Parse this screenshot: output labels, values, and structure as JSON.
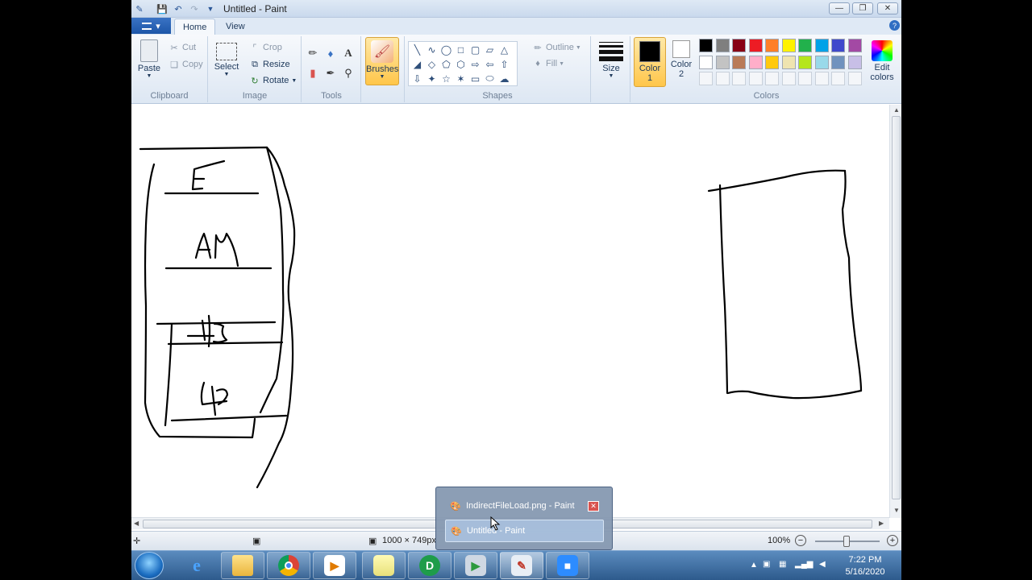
{
  "window": {
    "title": "Untitled - Paint",
    "quick_access_icons": [
      "save-icon",
      "undo-icon",
      "redo-icon"
    ]
  },
  "ribbon": {
    "file_button_label": "▾",
    "tabs": [
      {
        "label": "Home",
        "active": true
      },
      {
        "label": "View",
        "active": false
      }
    ],
    "clipboard": {
      "group_label": "Clipboard",
      "paste_label": "Paste",
      "cut_label": "Cut",
      "copy_label": "Copy"
    },
    "image": {
      "group_label": "Image",
      "select_label": "Select",
      "crop_label": "Crop",
      "resize_label": "Resize",
      "rotate_label": "Rotate"
    },
    "tools": {
      "group_label": "Tools"
    },
    "brushes": {
      "label": "Brushes"
    },
    "shapes": {
      "group_label": "Shapes",
      "outline_label": "Outline",
      "fill_label": "Fill"
    },
    "size": {
      "label": "Size"
    },
    "colors": {
      "group_label": "Colors",
      "color1_label": "Color",
      "color1_num": "1",
      "color2_label": "Color",
      "color2_num": "2",
      "edit_label": "Edit",
      "edit_label2": "colors",
      "color1_value": "#000000",
      "color2_value": "#ffffff",
      "palette_row1": [
        "#000000",
        "#7f7f7f",
        "#880015",
        "#ed1c24",
        "#ff7f27",
        "#fff200",
        "#22b14c",
        "#00a2e8",
        "#3f48cc",
        "#a349a4"
      ],
      "palette_row2": [
        "#ffffff",
        "#c3c3c3",
        "#b97a57",
        "#ffaec9",
        "#ffc90e",
        "#efe4b0",
        "#b5e61d",
        "#99d9ea",
        "#7092be",
        "#c8bfe7"
      ]
    }
  },
  "status": {
    "canvas_size": "1000 × 749px",
    "zoom": "100%"
  },
  "taskbar": {
    "popup_items": [
      {
        "label": "IndirectFileLoad.png - Paint"
      },
      {
        "label": "Untitled - Paint"
      }
    ],
    "clock_time": "7:22 PM",
    "clock_date": "5/16/2020"
  }
}
